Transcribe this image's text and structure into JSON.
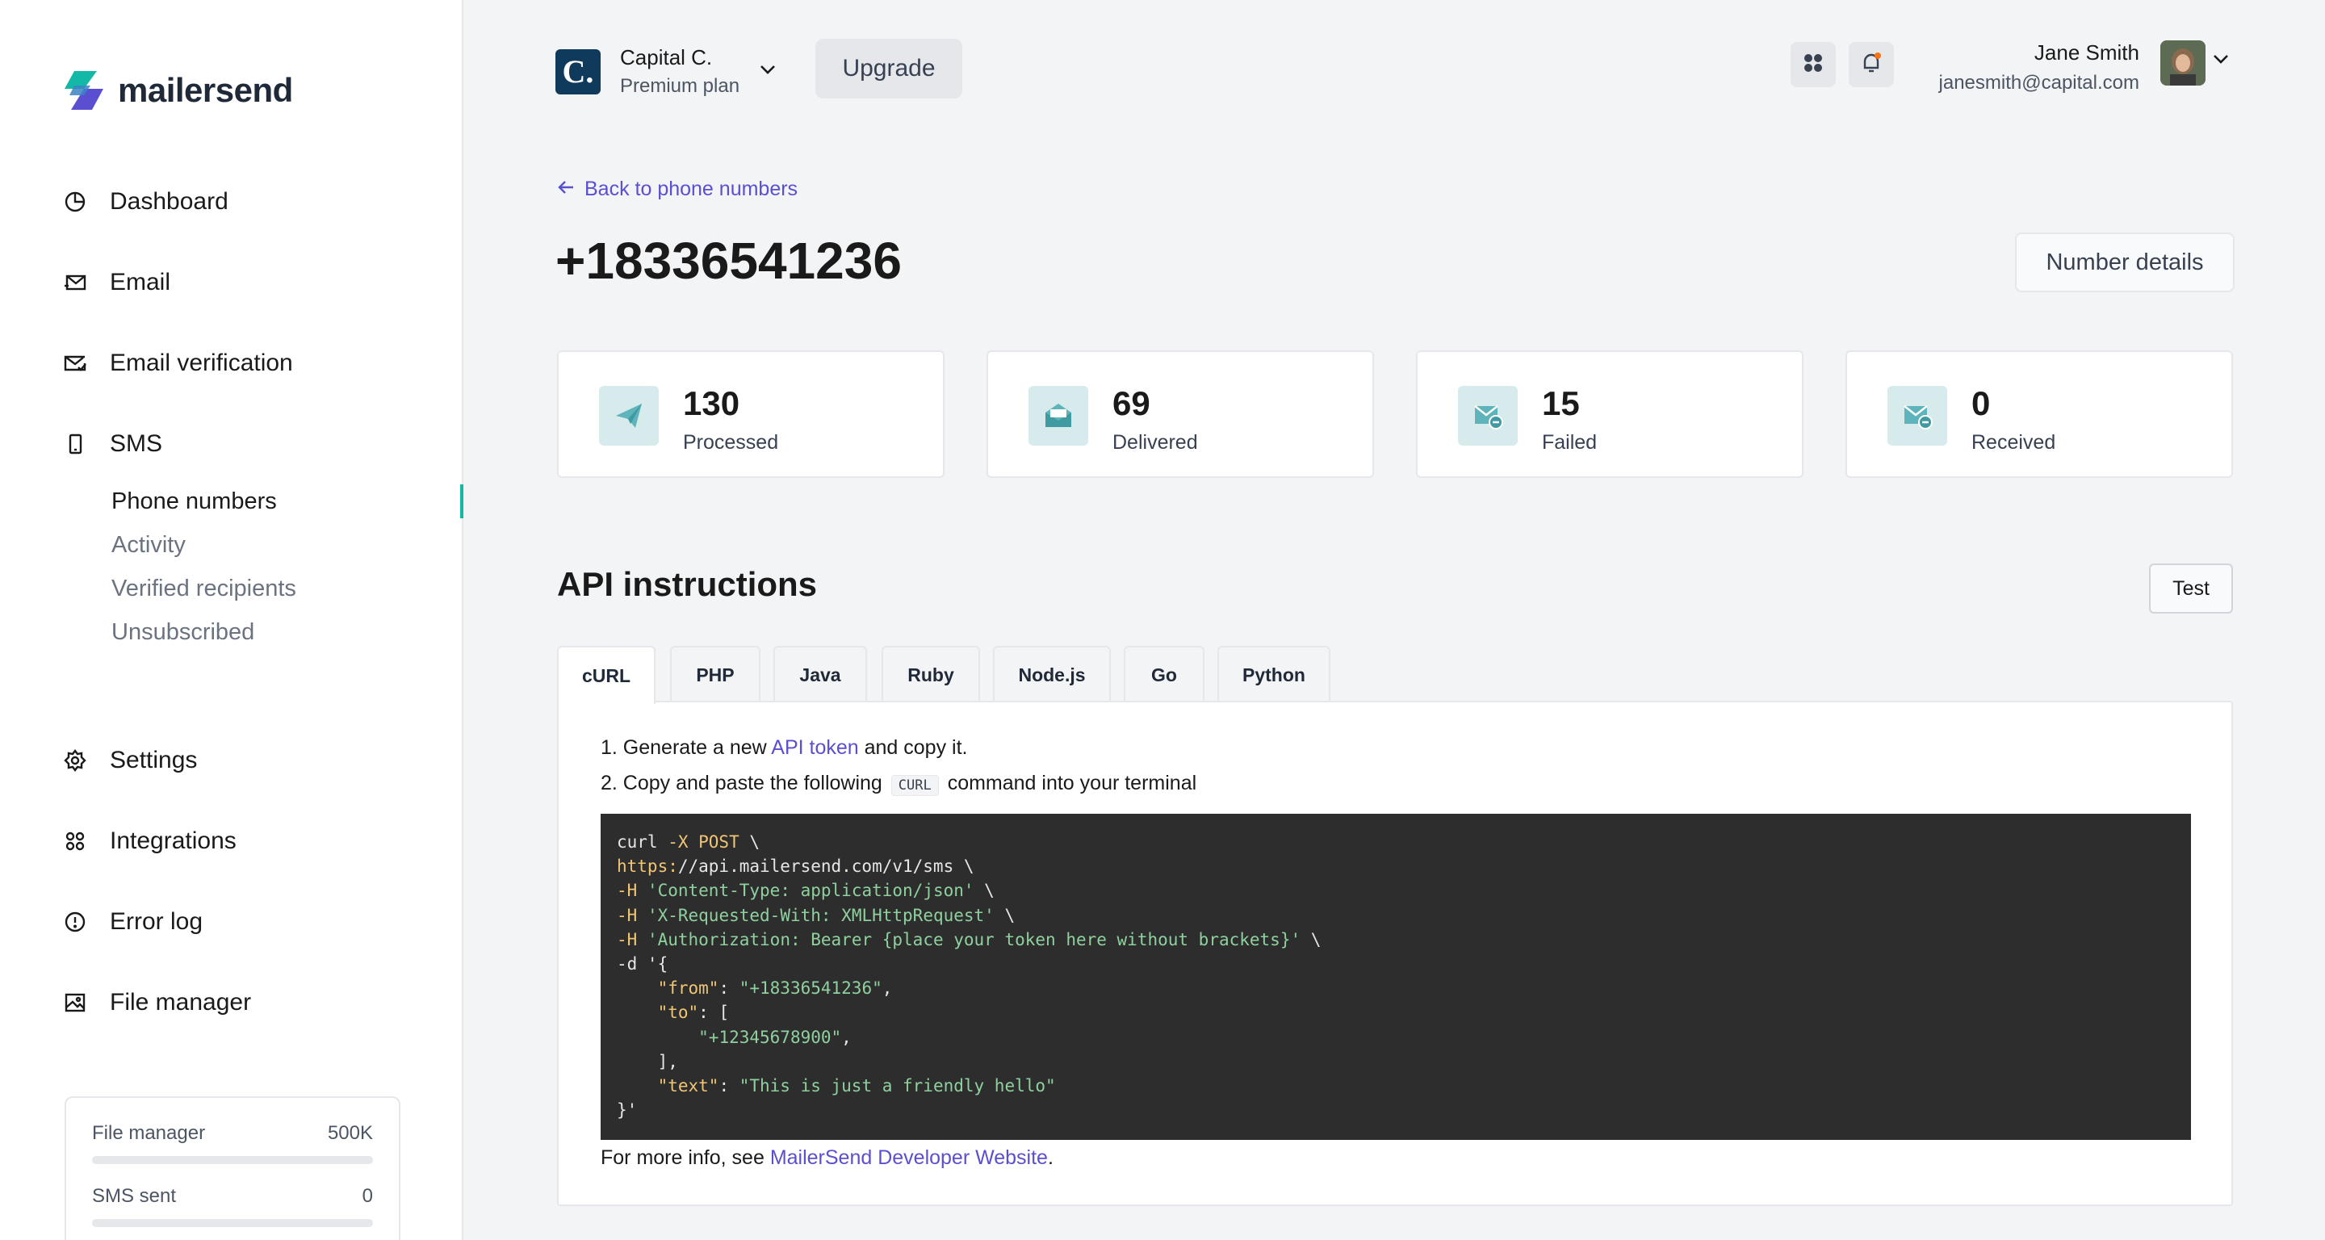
{
  "brand": {
    "name": "mailersend"
  },
  "sidebar": {
    "items": [
      {
        "label": "Dashboard",
        "icon": "pie-chart-icon"
      },
      {
        "label": "Email",
        "icon": "envelope-send-icon"
      },
      {
        "label": "Email verification",
        "icon": "envelope-check-icon"
      },
      {
        "label": "SMS",
        "icon": "phone-icon"
      },
      {
        "label": "Settings",
        "icon": "gear-icon"
      },
      {
        "label": "Integrations",
        "icon": "grid-icon"
      },
      {
        "label": "Error log",
        "icon": "alert-circle-icon"
      },
      {
        "label": "File manager",
        "icon": "image-icon"
      }
    ],
    "sms_subitems": [
      "Phone numbers",
      "Activity",
      "Verified recipients",
      "Unsubscribed"
    ],
    "active_subitem": "Phone numbers",
    "usage": [
      {
        "label": "File manager",
        "value": "500K",
        "fraction": 0
      },
      {
        "label": "SMS sent",
        "value": "0",
        "fraction": 0
      }
    ]
  },
  "header": {
    "org_name": "Capital C.",
    "org_plan": "Premium plan",
    "org_initial": "C.",
    "upgrade_label": "Upgrade",
    "user_name": "Jane Smith",
    "user_email": "janesmith@capital.com"
  },
  "page": {
    "back_label": "Back to phone numbers",
    "title": "+18336541236",
    "details_button": "Number details"
  },
  "stats": [
    {
      "value": "130",
      "label": "Processed",
      "icon": "paper-plane-icon"
    },
    {
      "value": "69",
      "label": "Delivered",
      "icon": "envelope-open-icon"
    },
    {
      "value": "15",
      "label": "Failed",
      "icon": "envelope-minus-icon"
    },
    {
      "value": "0",
      "label": "Received",
      "icon": "envelope-minus-icon"
    }
  ],
  "api": {
    "title": "API instructions",
    "test_button": "Test",
    "tabs": [
      "cURL",
      "PHP",
      "Java",
      "Ruby",
      "Node.js",
      "Go",
      "Python"
    ],
    "active_tab": "cURL",
    "step1_pre": "1. Generate a new ",
    "step1_link": "API token",
    "step1_post": " and copy it.",
    "step2_pre": "2. Copy and paste the following ",
    "step2_code": "CURL",
    "step2_post": " command into your terminal",
    "code": {
      "l1_cmd": "curl ",
      "l1_flag": "-X POST",
      "l1_end": " \\",
      "l2_url": "https:",
      "l2_rest": "//api.mailersend.com/v1/sms \\",
      "l3_flag": "-H",
      "l3_str": "'Content-Type: application/json'",
      "l3_end": " \\",
      "l4_flag": "-H",
      "l4_str": "'X-Requested-With: XMLHttpRequest'",
      "l4_end": " \\",
      "l5_flag": "-H",
      "l5_str": "'Authorization: Bearer {place your token here without brackets}'",
      "l5_end": " \\",
      "l6": "-d '{",
      "l7_key": "\"from\"",
      "l7_str": "\"+18336541236\"",
      "l8_key": "\"to\"",
      "l8_rest": ": [",
      "l9_str": "\"+12345678900\"",
      "l10": "    ],",
      "l11_key": "\"text\"",
      "l11_str": "\"This is just a friendly hello\"",
      "l12": "}'"
    },
    "more_pre": "For more info, see ",
    "more_link": "MailerSend Developer Website",
    "more_post": "."
  },
  "colors": {
    "accent": "#5b4fd1",
    "teal": "#14b8a6",
    "stat_icon_bg": "#d7ebec",
    "code_bg": "#2d2d2d"
  }
}
